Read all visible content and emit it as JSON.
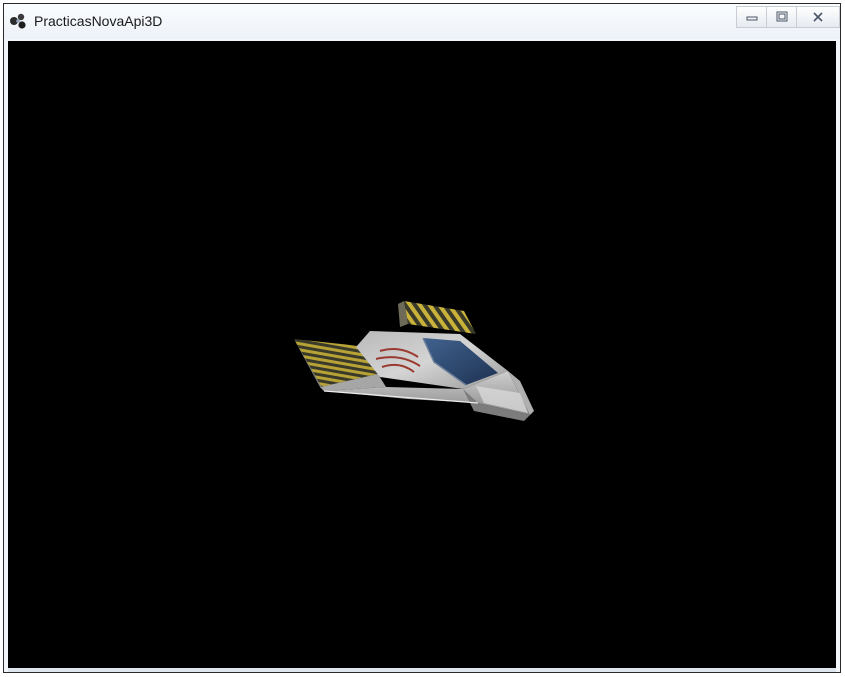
{
  "window": {
    "title": "PracticasNovaApi3D",
    "icons": {
      "app": "app-logo-icon",
      "minimize": "minimize-icon",
      "maximize": "maximize-icon",
      "close": "close-icon"
    }
  },
  "scene": {
    "background_color": "#000000",
    "object": "spaceship-model",
    "colors": {
      "hull": "#c9c9c9",
      "stripe_yellow": "#c9b23a",
      "stripe_dark": "#3a3a2a",
      "canopy": "#2f4a73",
      "decal": "#9a3a30"
    }
  }
}
